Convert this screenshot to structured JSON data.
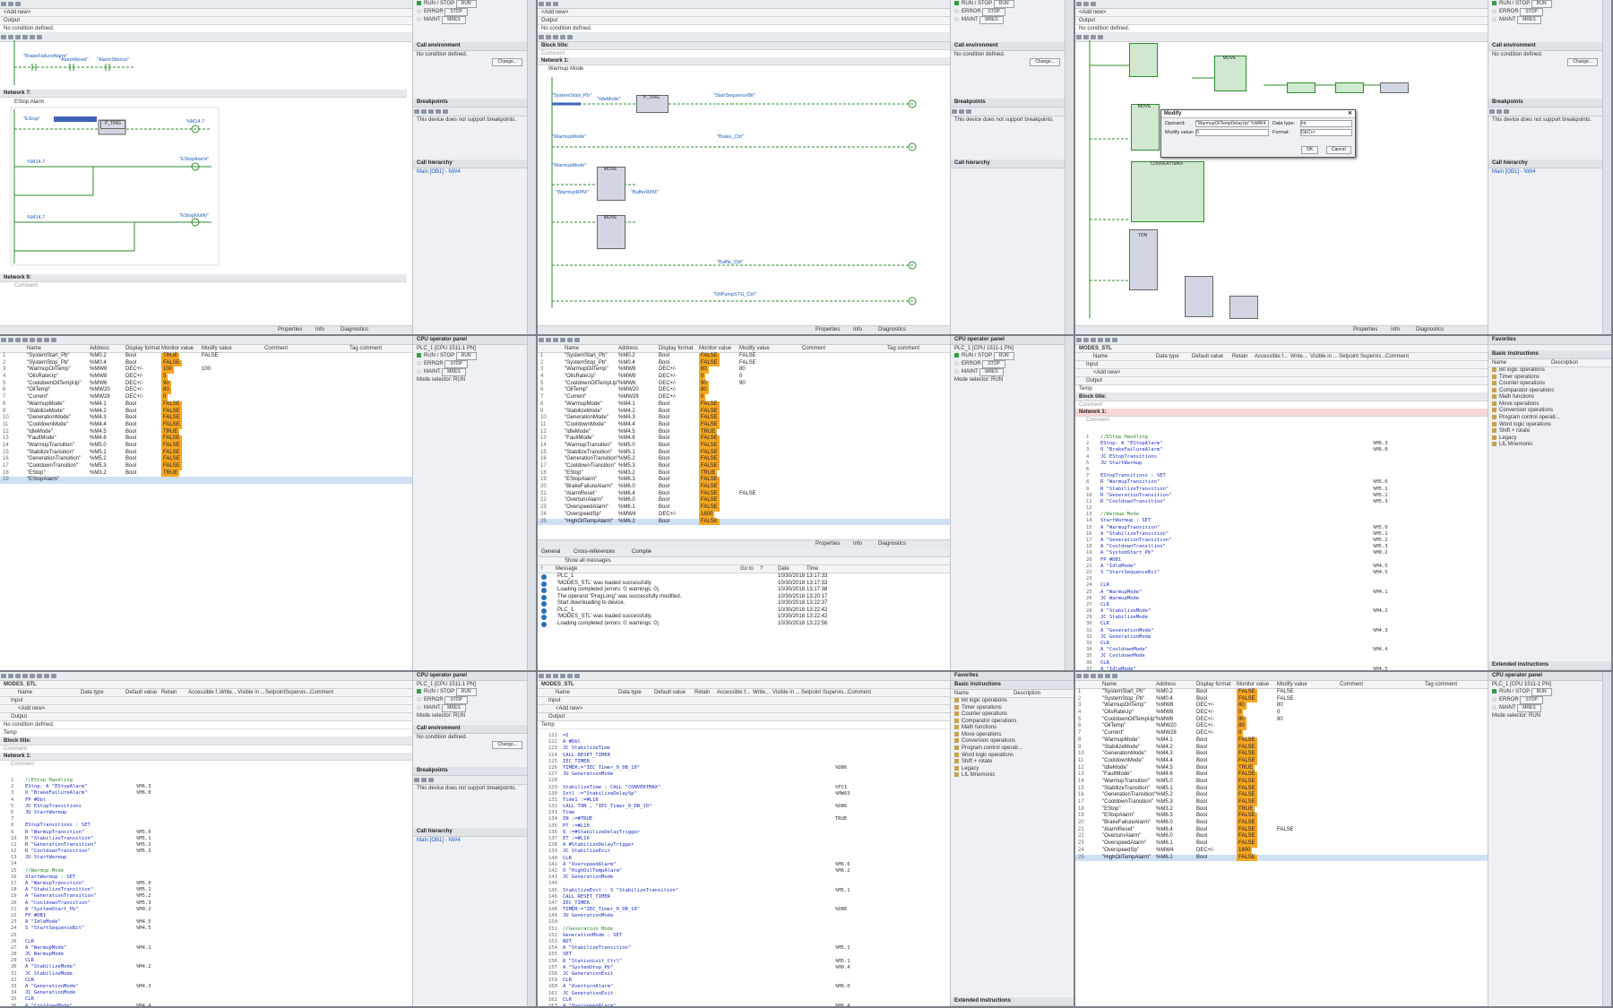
{
  "common": {
    "no_condition": "No condition defined.",
    "change_btn": "Change...",
    "call_env": "Call environment",
    "breakpoints": "Breakpoints",
    "bp_note": "This device does not support breakpoints.",
    "call_hierarchy": "Call hierarchy",
    "cpu_panel": "CPU operator panel",
    "plc_name": "PLC_1 [CPU 1511-1 PN]",
    "run_stop": "RUN / STOP",
    "error": "ERROR",
    "maint": "MAINT",
    "run_btn": "RUN",
    "stop_btn": "STOP",
    "mres_btn": "MRES",
    "mode_selector": "Mode selector:",
    "mode_value": "RUN",
    "properties": "Properties",
    "info": "Info",
    "diagnostics": "Diagnostics",
    "block_title": "Block title:",
    "comment": "Comment",
    "input": "Input",
    "output": "Output",
    "add_new": "<Add new>",
    "temp": "Temp",
    "modes_stl": "MODES_STL",
    "zoom": "100%",
    "favorites": "Favorites",
    "basic_instructions": "Basic instructions",
    "extended_instructions": "Extended instructions",
    "call_hier_link": "Main [OB1] - NW4"
  },
  "p1": {
    "network7": "Network 7:",
    "network7_comment": "EStop Alarm",
    "network9": "Network 9:",
    "op_brake": "\"BrakeFailureAlarm\"",
    "op_alarmreset": "\"AlarmReset\"",
    "op_alarmsilence": "\"AlarmSilence\"",
    "op_estop": "\"EStop\"",
    "op_estopalarm": "\"EStopAlarm\"",
    "op_estopnotify": "\"EStopNotify\"",
    "ptrg": "P_TRIG",
    "m147": "%M14.7",
    "addr_i": "%I4.0",
    "addr_m": "%M4.4",
    "addr_q": "%Q4.3"
  },
  "p2": {
    "network1": "Network 1:",
    "network1_comment": "Warmup Mode",
    "op_systemstart": "\"SystemStart_Pb\"",
    "op_idlemode": "\"IdleMode\"",
    "op_startseq": "\"StartSequenceBit\"",
    "op_warmupmode": "\"WarmupMode\"",
    "op_brakectrl": "\"Brake_Ctrl\"",
    "op_rpm": "\"WarmupRPM\"",
    "op_buffer": "\"BufferRPM\"",
    "op_bufferctrl": "\"Baffle_Ctrl\"",
    "op_oilpump": "\"OilPumpSTG_Ctrl\"",
    "move": "MOVE",
    "ptrg": "P_TRIG"
  },
  "p3": {
    "modify_title": "Modify",
    "operand_label": "Operand:",
    "operand_value": "\"WarmupOilTempDelayUp\" %MW4",
    "modify_value_label": "Modify value:",
    "modify_value": "0",
    "data_type_label": "Data type:",
    "data_type": "Int",
    "format_label": "Format:",
    "format": "DEC+/-",
    "ok": "OK",
    "cancel": "Cancel",
    "move": "MOVE",
    "conv": "CONVERT/MAX",
    "in": "IN",
    "out": "OUT1",
    "ton": "TON",
    "timer": "\"IEC_Timer_0_DB_10\""
  },
  "watch": {
    "headers": [
      "Name",
      "Address",
      "Display format",
      "Monitor value",
      "Modify value",
      "",
      "Comment",
      "Tag comment"
    ],
    "rows": [
      [
        "\"SystemStart_Pb\"",
        "%M0.2",
        "Bool",
        "TRUE",
        "FALSE"
      ],
      [
        "\"SystemStop_Pb\"",
        "%M0.4",
        "Bool",
        "FALSE",
        ""
      ],
      [
        "\"WarmupOilTemp\"",
        "%MW8",
        "DEC+/-",
        "100",
        "100"
      ],
      [
        "\"OilsRateUp\"",
        "%MW8",
        "DEC+/-",
        "5",
        ""
      ],
      [
        "\"CooldownOilTempUp\"",
        "%MW6",
        "DEC+/-",
        "90",
        ""
      ],
      [
        "\"OilTemp\"",
        "%MW20",
        "DEC+/-",
        "80",
        ""
      ],
      [
        "\"Current\"",
        "%MW28",
        "DEC+/-",
        "0",
        ""
      ],
      [
        "\"WarmupMode\"",
        "%M4.1",
        "Bool",
        "FALSE",
        ""
      ],
      [
        "\"StabilizeMode\"",
        "%M4.2",
        "Bool",
        "FALSE",
        ""
      ],
      [
        "\"GenerationMode\"",
        "%M4.3",
        "Bool",
        "FALSE",
        ""
      ],
      [
        "\"CooldownMode\"",
        "%M4.4",
        "Bool",
        "FALSE",
        ""
      ],
      [
        "\"IdleMode\"",
        "%M4.5",
        "Bool",
        "TRUE",
        ""
      ],
      [
        "\"FaultMode\"",
        "%M4.6",
        "Bool",
        "FALSE",
        ""
      ],
      [
        "\"WarmupTransition\"",
        "%M5.0",
        "Bool",
        "FALSE",
        ""
      ],
      [
        "\"StabilizeTransition\"",
        "%M5.1",
        "Bool",
        "FALSE",
        ""
      ],
      [
        "\"GenerationTransition\"",
        "%M5.2",
        "Bool",
        "FALSE",
        ""
      ],
      [
        "\"CooldownTransition\"",
        "%M5.3",
        "Bool",
        "FALSE",
        ""
      ],
      [
        "\"EStop\"",
        "%M3.2",
        "Bool",
        "TRUE",
        ""
      ],
      [
        "\"EStopAlarm\"",
        "",
        "",
        "",
        ""
      ]
    ],
    "rows2": [
      [
        "\"SystemStart_Pb\"",
        "%M0.2",
        "Bool",
        "FALSE",
        "FALSE"
      ],
      [
        "\"SystemStop_Pb\"",
        "%M0.4",
        "Bool",
        "FALSE",
        "FALSE"
      ],
      [
        "\"WarmupOilTemp\"",
        "%MW8",
        "DEC+/-",
        "80",
        "80"
      ],
      [
        "\"OilsRateUp\"",
        "%MW8",
        "DEC+/-",
        "0",
        "0"
      ],
      [
        "\"CooldownOilTempUp\"",
        "%MW6",
        "DEC+/-",
        "90",
        "90"
      ],
      [
        "\"OilTemp\"",
        "%MW20",
        "DEC+/-",
        "80",
        ""
      ],
      [
        "\"Current\"",
        "%MW28",
        "DEC+/-",
        "0",
        ""
      ],
      [
        "\"WarmupMode\"",
        "%M4.1",
        "Bool",
        "FALSE",
        ""
      ],
      [
        "\"StabilizeMode\"",
        "%M4.2",
        "Bool",
        "FALSE",
        ""
      ],
      [
        "\"GenerationMode\"",
        "%M4.3",
        "Bool",
        "FALSE",
        ""
      ],
      [
        "\"CooldownMode\"",
        "%M4.4",
        "Bool",
        "FALSE",
        ""
      ],
      [
        "\"IdleMode\"",
        "%M4.5",
        "Bool",
        "TRUE",
        ""
      ],
      [
        "\"FaultMode\"",
        "%M4.6",
        "Bool",
        "FALSE",
        ""
      ],
      [
        "\"WarmupTransition\"",
        "%M5.0",
        "Bool",
        "FALSE",
        ""
      ],
      [
        "\"StabilizeTransition\"",
        "%M5.1",
        "Bool",
        "FALSE",
        ""
      ],
      [
        "\"GenerationTransition\"",
        "%M5.2",
        "Bool",
        "FALSE",
        ""
      ],
      [
        "\"CooldownTransition\"",
        "%M5.3",
        "Bool",
        "FALSE",
        ""
      ],
      [
        "\"EStop\"",
        "%M3.2",
        "Bool",
        "TRUE",
        ""
      ],
      [
        "\"EStopAlarm\"",
        "%M6.3",
        "Bool",
        "FALSE",
        ""
      ],
      [
        "\"BrakeFailureAlarm\"",
        "%M6.0",
        "Bool",
        "FALSE",
        ""
      ],
      [
        "\"AlarmReset\"",
        "%M6.4",
        "Bool",
        "FALSE",
        "FALSE"
      ],
      [
        "\"OverturnAlarm\"",
        "%M6.0",
        "Bool",
        "FALSE",
        ""
      ],
      [
        "\"OverspeedAlarm\"",
        "%M6.1",
        "Bool",
        "FALSE",
        ""
      ],
      [
        "\"OverspeedSp\"",
        "%MW4",
        "DEC+/-",
        "1800",
        ""
      ],
      [
        "\"HighOilTempAlarm\"",
        "%M6.2",
        "Bool",
        "FALSE",
        ""
      ]
    ]
  },
  "msgs": {
    "tabs": [
      "General",
      "Cross-references",
      "Compile"
    ],
    "filter": "Show all messages",
    "headers": [
      "!",
      "Message",
      "Go to",
      "?",
      "Date",
      "Time"
    ],
    "rows": [
      [
        "PLC_1",
        "",
        "10/30/2018",
        "13:17:33"
      ],
      [
        "'MODES_STL' was loaded successfully.",
        "",
        "10/30/2018",
        "13:17:33"
      ],
      [
        "Loading completed (errors: 0; warnings: 0).",
        "",
        "10/30/2018",
        "13:17:38"
      ],
      [
        "The operand \"ProgLong\" was successfully modified.",
        "",
        "10/30/2018",
        "13:20:17"
      ],
      [
        "Start downloading to device.",
        "",
        "10/30/2018",
        "13:22:37"
      ],
      [
        "PLC_1",
        "",
        "10/30/2018",
        "13:22:42"
      ],
      [
        "'MODES_STL' was loaded successfully.",
        "",
        "10/30/2018",
        "13:22:42"
      ],
      [
        "Loading completed (errors: 0; warnings: 0).",
        "",
        "10/30/2018",
        "13:22:56"
      ]
    ]
  },
  "iface": {
    "headers": [
      "Name",
      "Data type",
      "Default value",
      "Retain",
      "Accessible f...",
      "Write...",
      "Visible in ...",
      "Setpoint",
      "Supervis...",
      "Comment"
    ]
  },
  "stl1": {
    "lines": [
      [
        "1",
        "//EStop Handling",
        ""
      ],
      [
        "2",
        "EStop: A  \"EStopAlarm\"",
        "%M6.3"
      ],
      [
        "3",
        "     O   \"BrakeFailureAlarm\"",
        "%M6.0"
      ],
      [
        "4",
        "     FP  #Dbl",
        ""
      ],
      [
        "5",
        "     JC  EStopTransitions",
        ""
      ],
      [
        "6",
        "     JU  StartWarmup",
        ""
      ],
      [
        "7",
        "",
        ""
      ],
      [
        "8",
        "EStopTransitions : SET",
        ""
      ],
      [
        "9",
        "     R   \"WarmupTransition\"",
        "%M5.0"
      ],
      [
        "10",
        "     R   \"StabilizeTransition\"",
        "%M5.1"
      ],
      [
        "11",
        "     R   \"GenerationTransition\"",
        "%M5.2"
      ],
      [
        "12",
        "     R   \"CooldownTransition\"",
        "%M5.3"
      ],
      [
        "13",
        "     JU  StartWarmup",
        ""
      ],
      [
        "14",
        "",
        ""
      ],
      [
        "15",
        "//Warmup Mode",
        ""
      ],
      [
        "16",
        "StartWarmup : SET",
        ""
      ],
      [
        "17",
        "     A   \"WarmupTransition\"",
        "%M5.0"
      ],
      [
        "18",
        "     A   \"StabilizeTransition\"",
        "%M5.1"
      ],
      [
        "19",
        "     A   \"GenerationTransition\"",
        "%M5.2"
      ],
      [
        "20",
        "     A   \"CooldownTransition\"",
        "%M5.3"
      ],
      [
        "21",
        "     A   \"SystemStart_Pb\"",
        "%M0.2"
      ],
      [
        "22",
        "     FP  #DB1",
        ""
      ],
      [
        "23",
        "     A   \"IdleMode\"",
        "%M4.5"
      ],
      [
        "24",
        "     S   \"StartSequenceBit\"",
        "%M4.5"
      ],
      [
        "25",
        "",
        ""
      ],
      [
        "26",
        "     CLR",
        ""
      ],
      [
        "27",
        "     A   \"WarmupMode\"",
        "%M4.1"
      ],
      [
        "28",
        "     JC  WarmupMode",
        ""
      ],
      [
        "29",
        "     CLR",
        ""
      ],
      [
        "30",
        "     A   \"StabilizeMode\"",
        "%M4.2"
      ],
      [
        "31",
        "     JC  StabilizeMode",
        ""
      ],
      [
        "32",
        "     CLR",
        ""
      ],
      [
        "33",
        "     A   \"GenerationMode\"",
        "%M4.3"
      ],
      [
        "34",
        "     JC  GenerationMode",
        ""
      ],
      [
        "35",
        "     CLR",
        ""
      ],
      [
        "36",
        "     A   \"CooldownMode\"",
        "%M4.4"
      ]
    ]
  },
  "stl2": {
    "lines": [
      [
        "121",
        "     =I",
        ""
      ],
      [
        "122",
        "     A   #Dbl",
        ""
      ],
      [
        "123",
        "     JC  StabilizeTime",
        ""
      ],
      [
        "124",
        "     CALL  RESET_TIMER",
        ""
      ],
      [
        "125",
        "       IEC_TIMER",
        ""
      ],
      [
        "126",
        "       TIMER:=\"IEC_Timer_0_DB_10\"",
        "%DB6"
      ],
      [
        "127",
        "     JU  GenerationMode",
        ""
      ],
      [
        "128",
        "",
        ""
      ],
      [
        "129",
        "StabilizeTime : CALL \"CONVERTMAX\"",
        "%FC1"
      ],
      [
        "130",
        "     Intl :=\"StabilizeDelaySp\"",
        "%MW03"
      ],
      [
        "131",
        "     Time1 :=#L10",
        ""
      ],
      [
        "132",
        "     CALL  TON , \"IEC_Timer_0_DB_10\"",
        "%DB6"
      ],
      [
        "133",
        "       Time",
        ""
      ],
      [
        "134",
        "       IN :=#TRUE",
        "TRUE"
      ],
      [
        "135",
        "       PT :=#L10",
        ""
      ],
      [
        "136",
        "       Q  :=#StabilizeDelayTrigger",
        ""
      ],
      [
        "137",
        "       ET :=#L16",
        ""
      ],
      [
        "138",
        "     A   #StabilizeDelayTrigger",
        ""
      ],
      [
        "139",
        "     JC  StabilizeExit",
        ""
      ],
      [
        "140",
        "     CLR",
        ""
      ],
      [
        "141",
        "     A   \"OverspeedAlarm\"",
        "%M6.6"
      ],
      [
        "142",
        "     O   \"HighOilTempAlarm\"",
        "%M6.2"
      ],
      [
        "143",
        "     JC  GenerationMode",
        ""
      ],
      [
        "144",
        "",
        ""
      ],
      [
        "145",
        "StabilizeExit : S \"StabilizeTransition\"",
        "%M5.1"
      ],
      [
        "146",
        "     CALL  RESET_TIMER",
        ""
      ],
      [
        "147",
        "       IEC_TIMER",
        ""
      ],
      [
        "148",
        "       TIMER:=\"IEC_Timer_0_DB_10\"",
        "%DB6"
      ],
      [
        "149",
        "     JU  GenerationMode",
        ""
      ],
      [
        "150",
        "",
        ""
      ],
      [
        "151",
        "//Generation Mode",
        ""
      ],
      [
        "152",
        "GenerationMode : SET",
        ""
      ],
      [
        "153",
        "     NOT",
        ""
      ],
      [
        "154",
        "     A   \"StabilizeTransition\"",
        "%M5.1"
      ],
      [
        "155",
        "     SET",
        ""
      ],
      [
        "156",
        "     R   \"StationLoit_Ctrl\"",
        "%M5.1"
      ],
      [
        "157",
        "     A   \"SystemStop_Pb\"",
        "%M0.4"
      ],
      [
        "158",
        "     JC  GenerationExit",
        ""
      ],
      [
        "159",
        "     CLR",
        ""
      ],
      [
        "160",
        "     A   \"OverturnAlarm\"",
        "%M6.0"
      ],
      [
        "161",
        "     JC  GenerationExit",
        ""
      ],
      [
        "162",
        "     CLR",
        ""
      ],
      [
        "163",
        "     A   \"OverspeedAlarm\"",
        "%M6.4"
      ]
    ]
  },
  "stl3": {
    "lines": [
      [
        "1",
        "//EStop Handling",
        ""
      ],
      [
        "2",
        "EStop: A  \"EStopAlarm\"",
        "%M6.3"
      ],
      [
        "3",
        "     O   \"BrakeFailureAlarm\"",
        "%M6.0"
      ],
      [
        "4",
        "     JC  EStopTransitions",
        ""
      ],
      [
        "5",
        "     JU  StartWarmup",
        ""
      ],
      [
        "6",
        "",
        ""
      ],
      [
        "7",
        "EStopTransitions : SET",
        ""
      ],
      [
        "8",
        "     R   \"WarmupTransition\"",
        "%M5.0"
      ],
      [
        "9",
        "     R   \"StabilizeTransition\"",
        "%M5.1"
      ],
      [
        "10",
        "     R   \"GenerationTransition\"",
        "%M5.2"
      ],
      [
        "11",
        "     R   \"CooldownTransition\"",
        "%M5.3"
      ],
      [
        "12",
        "",
        ""
      ],
      [
        "13",
        "//Warmup Mode",
        ""
      ],
      [
        "14",
        "StartWarmup : SET",
        ""
      ],
      [
        "15",
        "     A   \"WarmupTransition\"",
        "%M5.0"
      ],
      [
        "16",
        "     A   \"StabilizeTransition\"",
        "%M5.1"
      ],
      [
        "17",
        "     A   \"GenerationTransition\"",
        "%M5.2"
      ],
      [
        "18",
        "     A   \"CooldownTransition\"",
        "%M5.3"
      ],
      [
        "19",
        "     A   \"SystemStart_Pb\"",
        "%M0.2"
      ],
      [
        "20",
        "     FP  #DB1",
        ""
      ],
      [
        "21",
        "     A   \"IdleMode\"",
        "%M4.5"
      ],
      [
        "22",
        "     S   \"StartSequenceBit\"",
        "%M4.5"
      ],
      [
        "23",
        "",
        ""
      ],
      [
        "24",
        "     CLR",
        ""
      ],
      [
        "25",
        "     A   \"WarmupMode\"",
        "%M4.1"
      ],
      [
        "26",
        "     JC  WarmupMode",
        ""
      ],
      [
        "27",
        "     CLR",
        ""
      ],
      [
        "28",
        "     A   \"StabilizeMode\"",
        "%M4.2"
      ],
      [
        "29",
        "     JC  StabilizeMode",
        ""
      ],
      [
        "30",
        "     CLR",
        ""
      ],
      [
        "31",
        "     A   \"GenerationMode\"",
        "%M4.3"
      ],
      [
        "32",
        "     JC  GenerationMode",
        ""
      ],
      [
        "33",
        "     CLR",
        ""
      ],
      [
        "34",
        "     A   \"CooldownMode\"",
        "%M4.4"
      ],
      [
        "35",
        "     JC  CooldownMode",
        ""
      ],
      [
        "36",
        "     CLR",
        ""
      ],
      [
        "37",
        "     A   \"IdleMode\"",
        "%M4.5"
      ]
    ]
  },
  "instructions": {
    "items": [
      "Bit logic operations",
      "Timer operations",
      "Counter operations",
      "Comparator operations",
      "Math functions",
      "Move operations",
      "Conversion operations",
      "Program control operati...",
      "Word logic operations",
      "Shift + rotate",
      "Legacy",
      "LIL Mnemonic"
    ],
    "cols": [
      "Name",
      "Description"
    ]
  }
}
